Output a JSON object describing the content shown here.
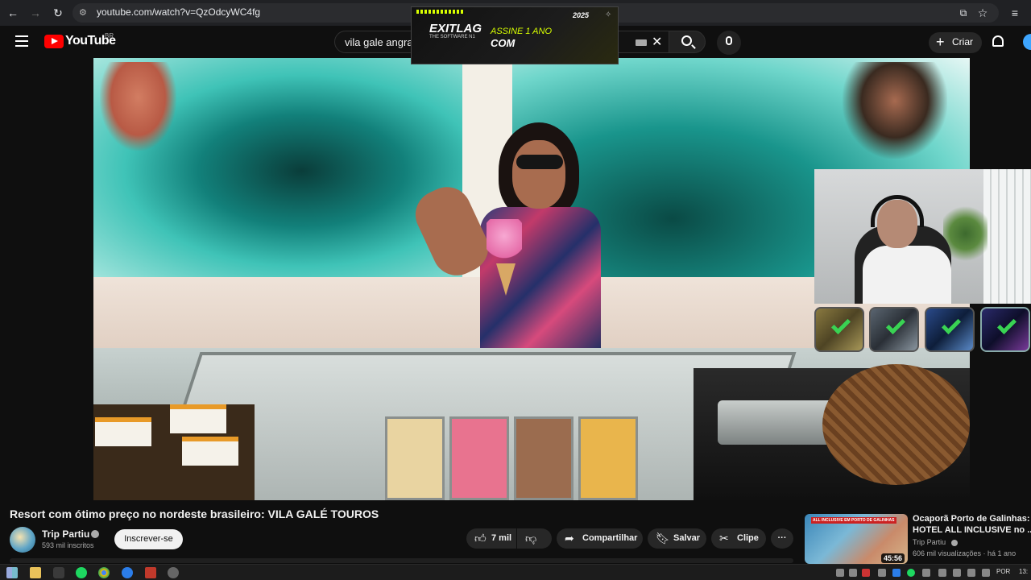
{
  "browser": {
    "url": "youtube.com/watch?v=QzOdcyWC4fg"
  },
  "youtube": {
    "logo_text": "YouTube",
    "country": "BR",
    "search_value": "vila gale angra",
    "create_label": "Criar"
  },
  "ad": {
    "brand": "EXITLAG",
    "tagline": "THE SOFTWARE N1",
    "line1": "ASSINE 1 ANO",
    "line2": "COM",
    "year": "2025"
  },
  "video": {
    "title": "Resort com ótimo preço no nordeste brasileiro: VILA GALÉ TOUROS"
  },
  "channel": {
    "name": "Trip Partiu",
    "subscribers": "593 mil inscritos",
    "subscribe_label": "Inscrever-se"
  },
  "actions": {
    "likes": "7 mil",
    "share": "Compartilhar",
    "save": "Salvar",
    "clip": "Clipe",
    "more": "···"
  },
  "recommendation": {
    "title_line1": "Ocaporã Porto de Galinhas:",
    "title_line2": "HOTEL ALL INCLUSIVE no ...",
    "channel": "Trip Partiu",
    "meta": "606 mil visualizações · há 1 ano",
    "duration": "45:56",
    "thumb_text": "ALL INCLUSIVE EM PORTO DE GALINHAS"
  },
  "taskbar": {
    "language": "POR",
    "clock": "13:"
  },
  "colors": {
    "yt_red": "#ff0000",
    "background": "#0f0f0f",
    "ad_accent": "#d8ff00",
    "check": "#39d353"
  }
}
